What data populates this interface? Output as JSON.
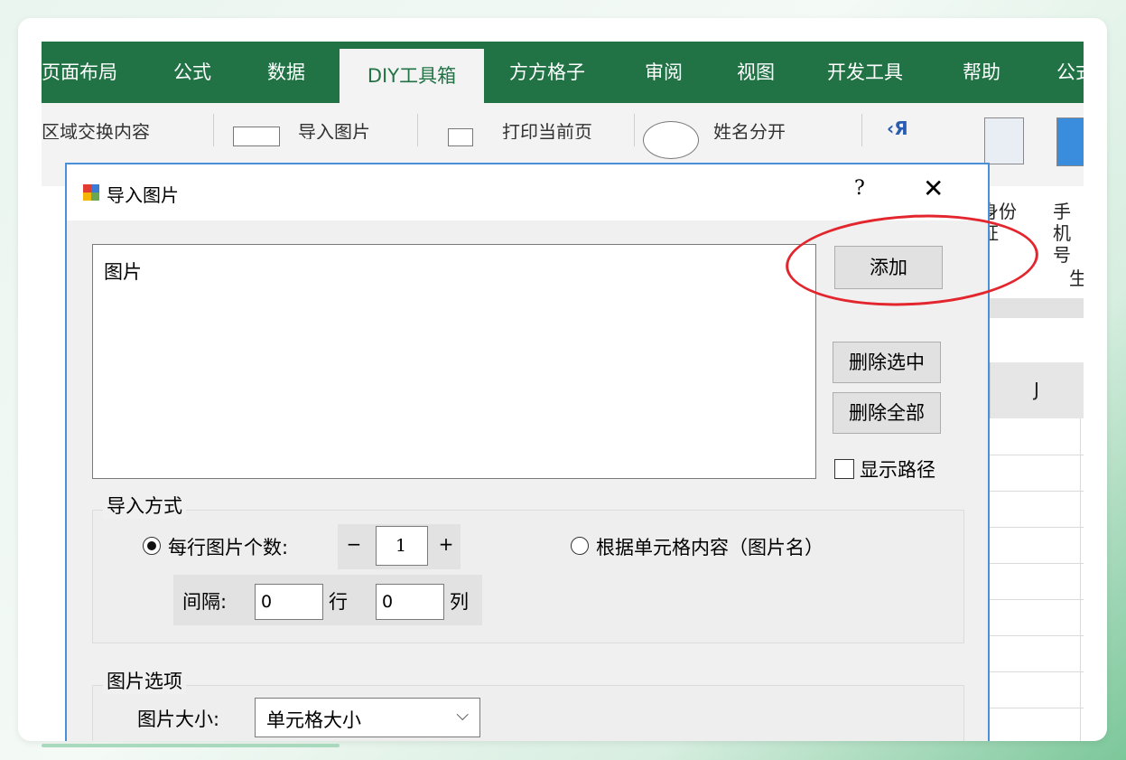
{
  "ribbon": {
    "tabs": [
      {
        "label": "页面布局",
        "active": false
      },
      {
        "label": "公式",
        "active": false
      },
      {
        "label": "数据",
        "active": false
      },
      {
        "label": "DIY工具箱",
        "active": true
      },
      {
        "label": "方方格子",
        "active": false
      },
      {
        "label": "审阅",
        "active": false
      },
      {
        "label": "视图",
        "active": false
      },
      {
        "label": "开发工具",
        "active": false
      },
      {
        "label": "帮助",
        "active": false
      },
      {
        "label": "公式",
        "active": false
      }
    ],
    "commands": {
      "swap_region": "区域交换内容",
      "import_picture": "导入图片",
      "print_current": "打印当前页",
      "split_name": "姓名分开"
    },
    "side": {
      "id_card": "身份证",
      "phone": "手机号",
      "group_label": "生"
    },
    "accent_color": "#217346"
  },
  "sheet": {
    "column_label": "J"
  },
  "dialog": {
    "title": "导入图片",
    "help": "?",
    "close": "✕",
    "list_header": "图片",
    "buttons": {
      "add": "添加",
      "delete_selected": "删除选中",
      "delete_all": "删除全部"
    },
    "show_path_label": "显示路径",
    "show_path_checked": false,
    "import_mode": {
      "legend": "导入方式",
      "per_row_label": "每行图片个数:",
      "per_row_selected": true,
      "minus": "−",
      "plus": "+",
      "per_row_value": "1",
      "by_cell_label": "根据单元格内容（图片名）",
      "by_cell_selected": false,
      "gap_label": "间隔:",
      "row_gap_value": "0",
      "row_unit": "行",
      "col_gap_value": "0",
      "col_unit": "列"
    },
    "picture_options": {
      "legend": "图片选项",
      "size_label": "图片大小:",
      "size_value": "单元格大小"
    }
  },
  "annotation_color": "#e3262e"
}
